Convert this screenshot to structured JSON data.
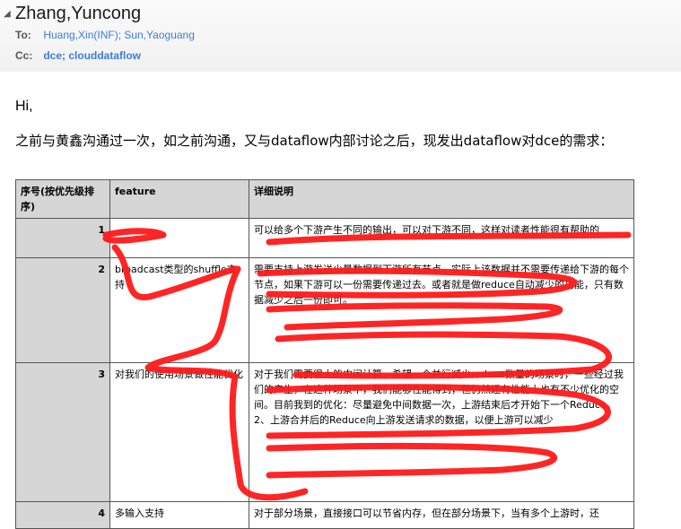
{
  "header": {
    "sender": "Zhang,Yuncong",
    "to_label": "To:",
    "to_value": "Huang,Xin(INF); Sun,Yaoguang",
    "cc_label": "Cc:",
    "cc_value": "dce; clouddataflow"
  },
  "body": {
    "greeting": "Hi,",
    "intro": "之前与黄鑫沟通过一次，如之前沟通，又与dataflow内部讨论之后，现发出dataflow对dce的需求："
  },
  "table": {
    "headers": [
      "序号(按优先级排序)",
      "feature",
      "详细说明"
    ],
    "rows": [
      {
        "num": "1",
        "feature": "",
        "detail": "可以给多个下游产生不同的输出，可以对下游不同，这样对读者性能很有帮助的"
      },
      {
        "num": "2",
        "feature": "broadcast类型的shuffle支持",
        "detail": "需要支持上游发送少量数据到下游所有节点。实际上该数据并不需要传递给下游的每个节点，如果下游可以一份需要传递过去。或者就是做reduce自动减少的功能，只有数据减少之后一份即可。"
      },
      {
        "num": "3",
        "feature": "对我们的使用场景做性能优化",
        "detail": "对于我们需要很大的中间计算，希望一个并行减少reduce数量的场景时，一些经过我们的产生，在这种场景中，我们能够性能得到，但仍然还有性能上也有不少优化的空间。目前我到的优化：尽量避免中间数据一次，上游结束后才开始下一个Reduce。2、上游合并后的Reduce向上游发送请求的数据，以便上游可以减少"
      },
      {
        "num": "4",
        "feature": "多输入支持",
        "detail": "对于部分场景，直接接口可以节省内存，但在部分场景下，当有多个上游时，还"
      }
    ]
  }
}
